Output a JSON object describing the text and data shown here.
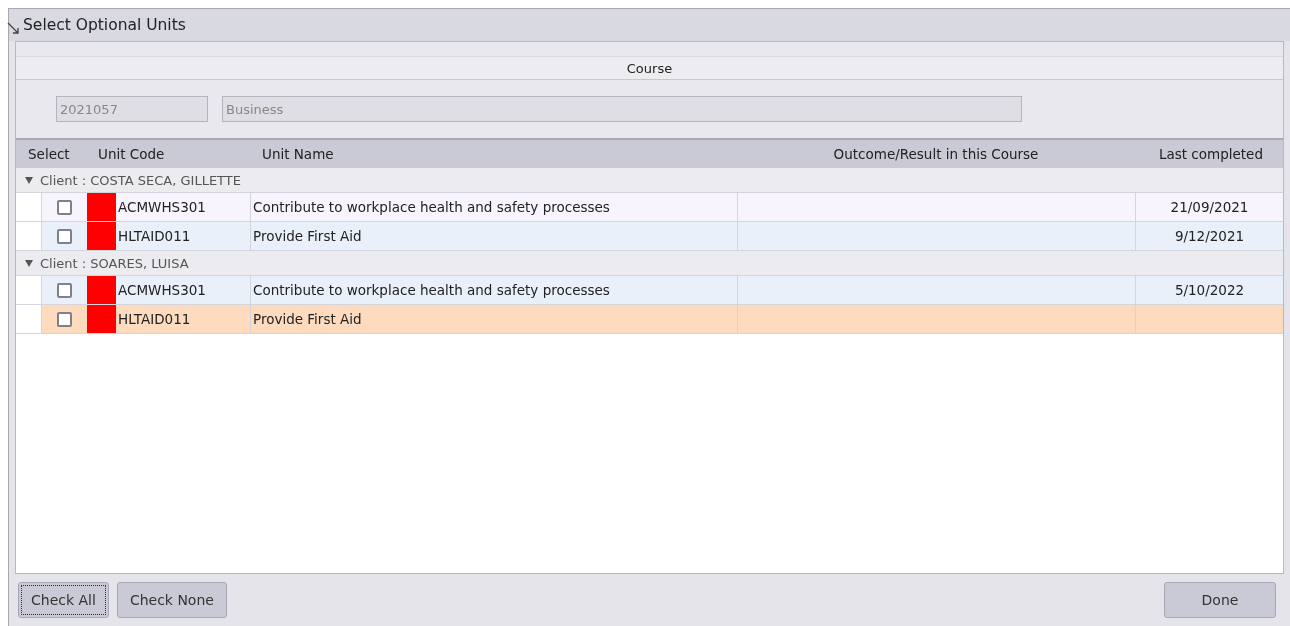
{
  "window": {
    "title": "Select Optional Units"
  },
  "course": {
    "heading": "Course",
    "code": "2021057",
    "name": "Business"
  },
  "table": {
    "columns": [
      "Select",
      "Unit Code",
      "Unit Name",
      "Outcome/Result in this Course",
      "Last completed"
    ],
    "groups": [
      {
        "label": "Client : COSTA SECA, GILLETTE",
        "expanded": true,
        "rows": [
          {
            "checked": false,
            "color": "#ff0000",
            "code": "ACMWHS301",
            "name": "Contribute to workplace health and safety processes",
            "last_completed": "21/09/2021",
            "selected": false,
            "alternate": false
          },
          {
            "checked": false,
            "color": "#ff0000",
            "code": "HLTAID011",
            "name": "Provide First Aid",
            "last_completed": "9/12/2021",
            "selected": false,
            "alternate": true
          }
        ]
      },
      {
        "label": "Client : SOARES, LUISA",
        "expanded": true,
        "rows": [
          {
            "checked": false,
            "color": "#ff0000",
            "code": "ACMWHS301",
            "name": "Contribute to workplace health and safety processes",
            "last_completed": "5/10/2022",
            "selected": false,
            "alternate": true
          },
          {
            "checked": false,
            "color": "#ff0000",
            "code": "HLTAID011",
            "name": "Provide First Aid",
            "selected": true
          }
        ]
      }
    ]
  },
  "buttons": [
    {
      "label": "Check All",
      "focused": true,
      "kind": "left"
    },
    {
      "label": "Check None",
      "focused": false,
      "kind": "left"
    },
    {
      "label": "Done",
      "focused": false,
      "kind": "right"
    }
  ]
}
